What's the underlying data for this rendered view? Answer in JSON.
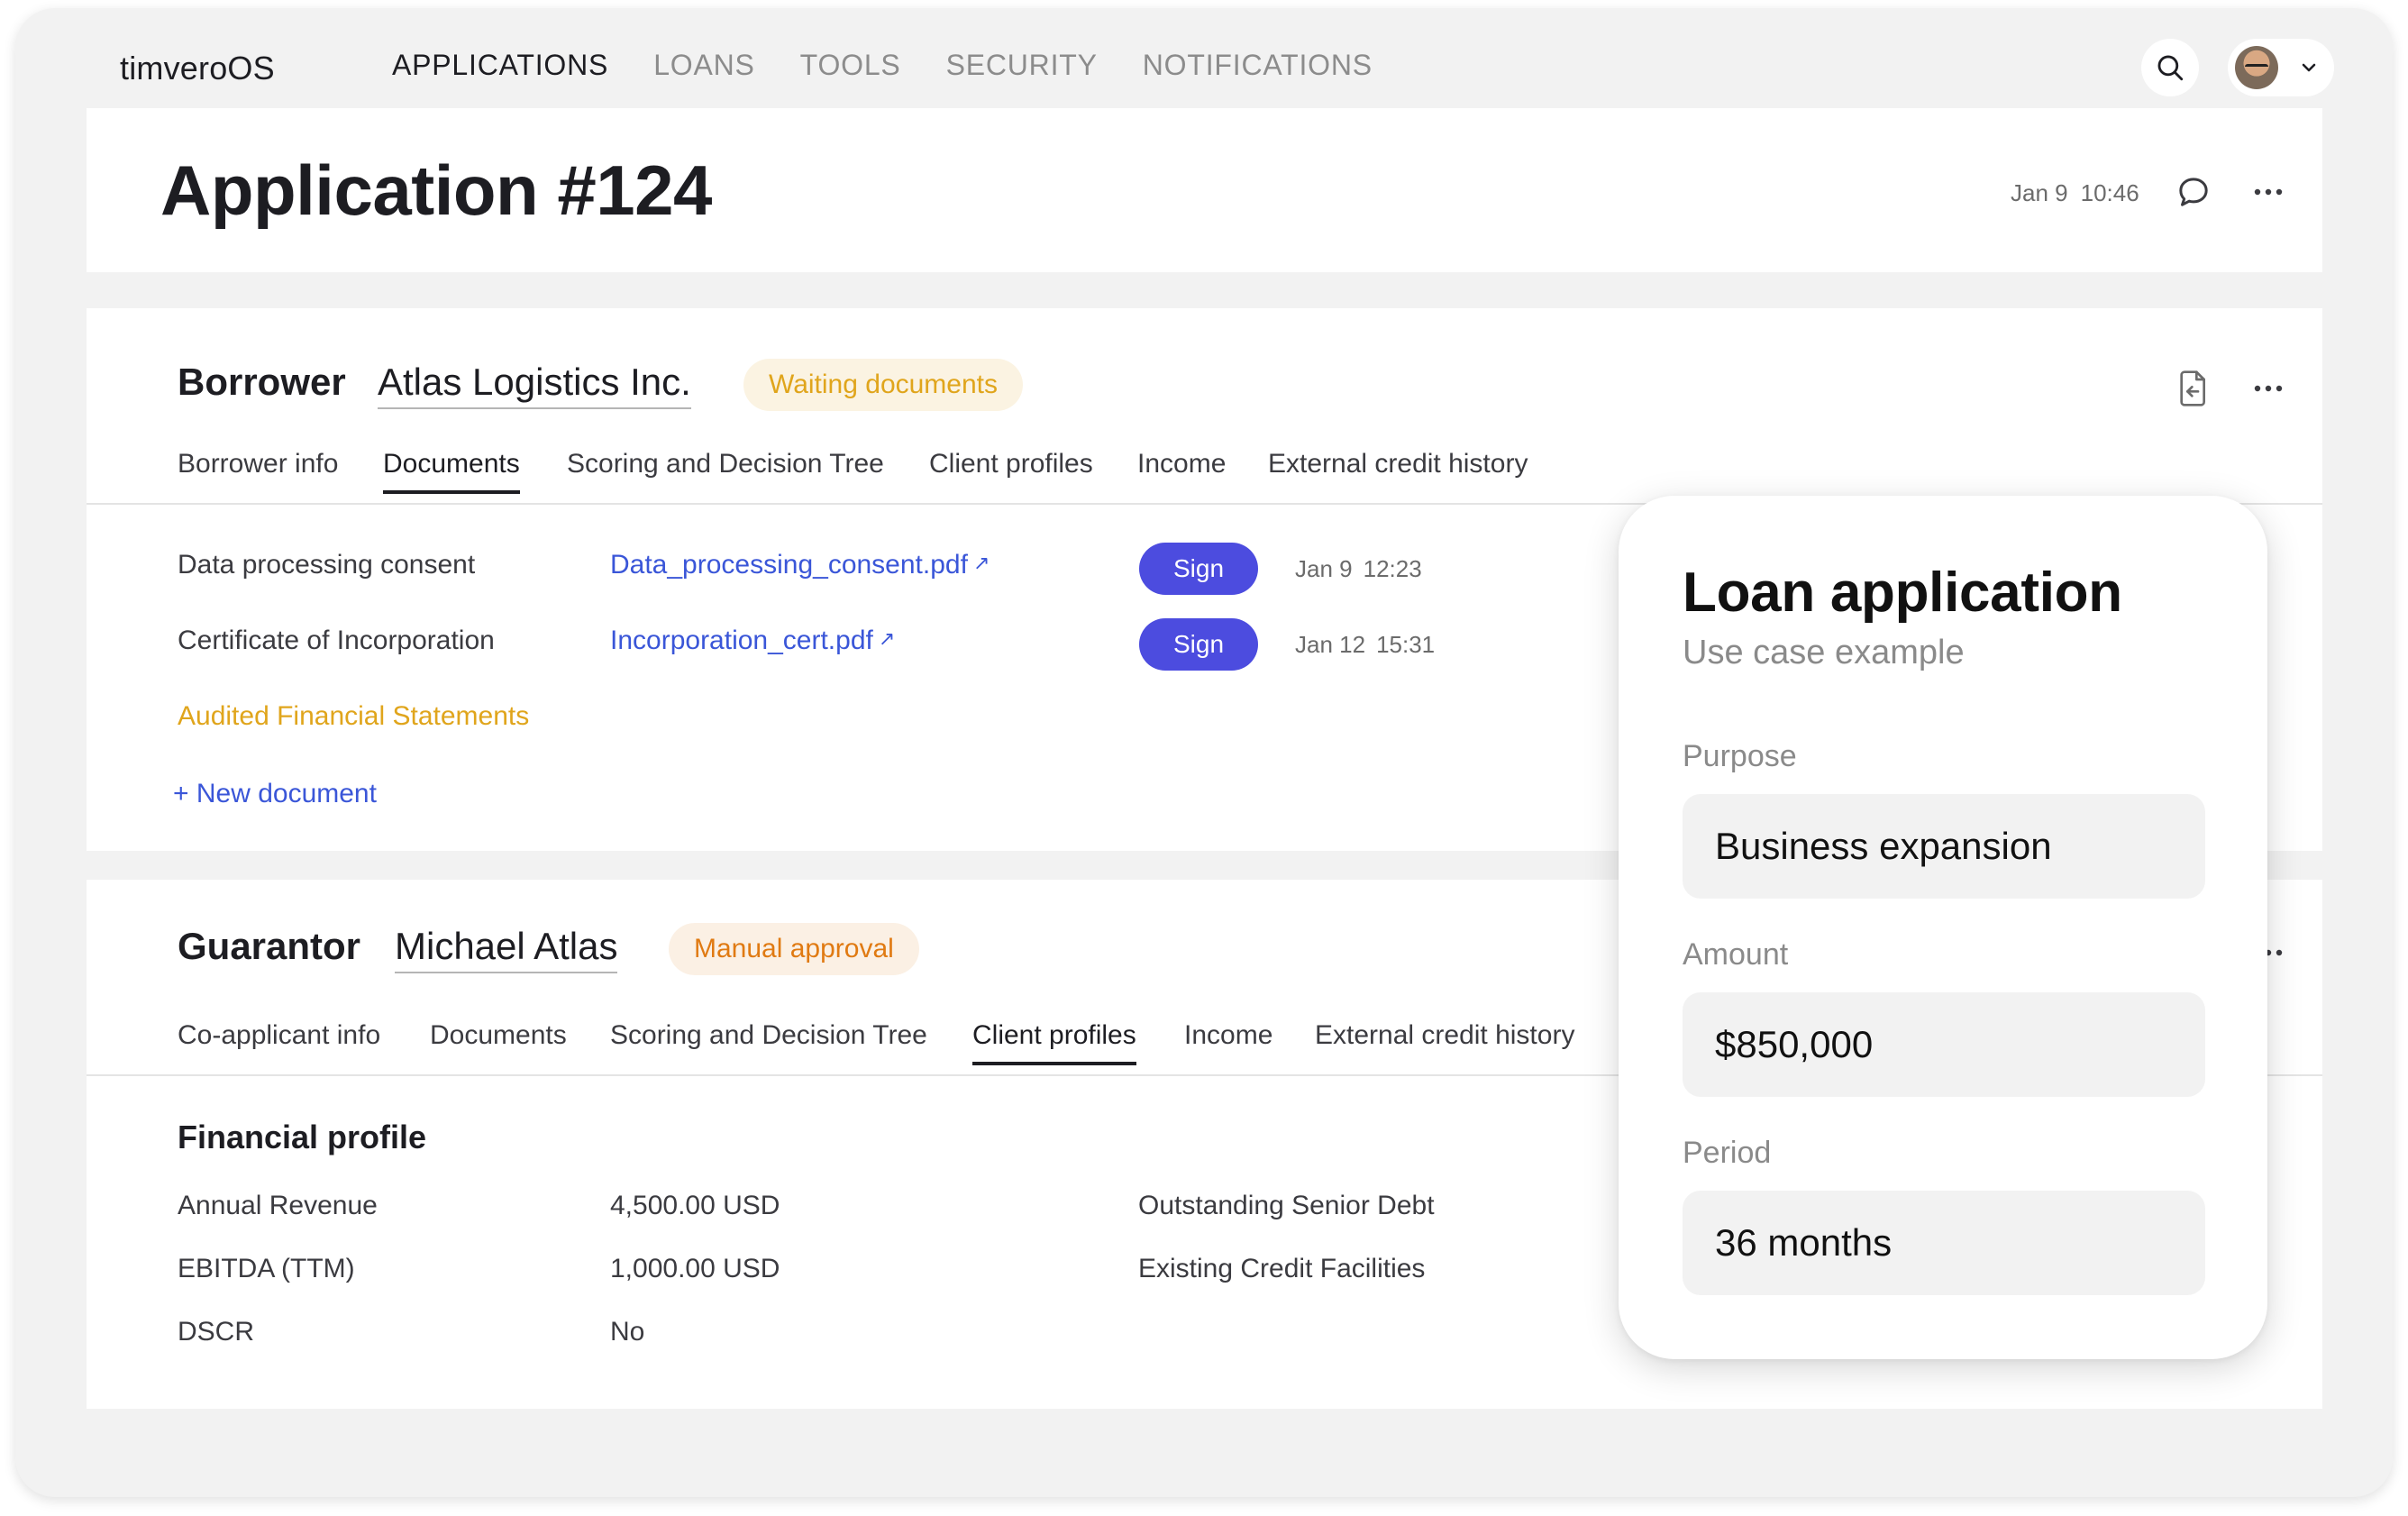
{
  "app": {
    "brand": "timveroOS",
    "nav": [
      {
        "label": "APPLICATIONS",
        "active": true
      },
      {
        "label": "LOANS",
        "active": false
      },
      {
        "label": "TOOLS",
        "active": false
      },
      {
        "label": "SECURITY",
        "active": false
      },
      {
        "label": "NOTIFICATIONS",
        "active": false
      }
    ]
  },
  "header": {
    "title": "Application #124",
    "date": "Jan 9",
    "time": "10:46"
  },
  "borrower": {
    "role": "Borrower",
    "name": "Atlas Logistics Inc.",
    "status": "Waiting documents",
    "tabs": [
      "Borrower info",
      "Documents",
      "Scoring and Decision Tree",
      "Client profiles",
      "Income",
      "External credit history"
    ],
    "active_tab": "Documents",
    "documents": [
      {
        "label": "Data processing consent",
        "file": "Data_processing_consent.pdf",
        "action": "Sign",
        "date": "Jan 9",
        "time": "12:23"
      },
      {
        "label": "Certificate of Incorporation",
        "file": "Incorporation_cert.pdf",
        "action": "Sign",
        "date": "Jan 12",
        "time": "15:31"
      },
      {
        "label": "Audited Financial Statements"
      }
    ],
    "new_document": "+ New document"
  },
  "guarantor": {
    "role": "Guarantor",
    "name": "Michael Atlas",
    "status": "Manual approval",
    "tabs": [
      "Co-applicant info",
      "Documents",
      "Scoring and Decision Tree",
      "Client profiles",
      "Income",
      "External credit history"
    ],
    "active_tab": "Client profiles",
    "section_title": "Financial profile",
    "rows": [
      {
        "label": "Annual Revenue",
        "value": "4,500.00 USD",
        "label2": "Outstanding Senior Debt"
      },
      {
        "label": "EBITDA (TTM)",
        "value": "1,000.00 USD",
        "label2": "Existing Credit Facilities"
      },
      {
        "label": "DSCR",
        "value": "No"
      }
    ]
  },
  "loan_card": {
    "title": "Loan application",
    "subtitle": "Use case example",
    "fields": [
      {
        "label": "Purpose",
        "value": "Business expansion"
      },
      {
        "label": "Amount",
        "value": "$850,000"
      },
      {
        "label": "Period",
        "value": "36 months"
      }
    ]
  },
  "icons": {
    "search": "search-icon",
    "chevron": "chevron-down-icon",
    "comment": "comment-icon",
    "more": "more-horizontal-icon",
    "export": "export-document-icon",
    "external_link": "external-link-icon"
  },
  "colors": {
    "accent": "#4c4cdf",
    "link": "#3a56d8",
    "waiting": "#e0a51c",
    "manual": "#e07a12"
  }
}
